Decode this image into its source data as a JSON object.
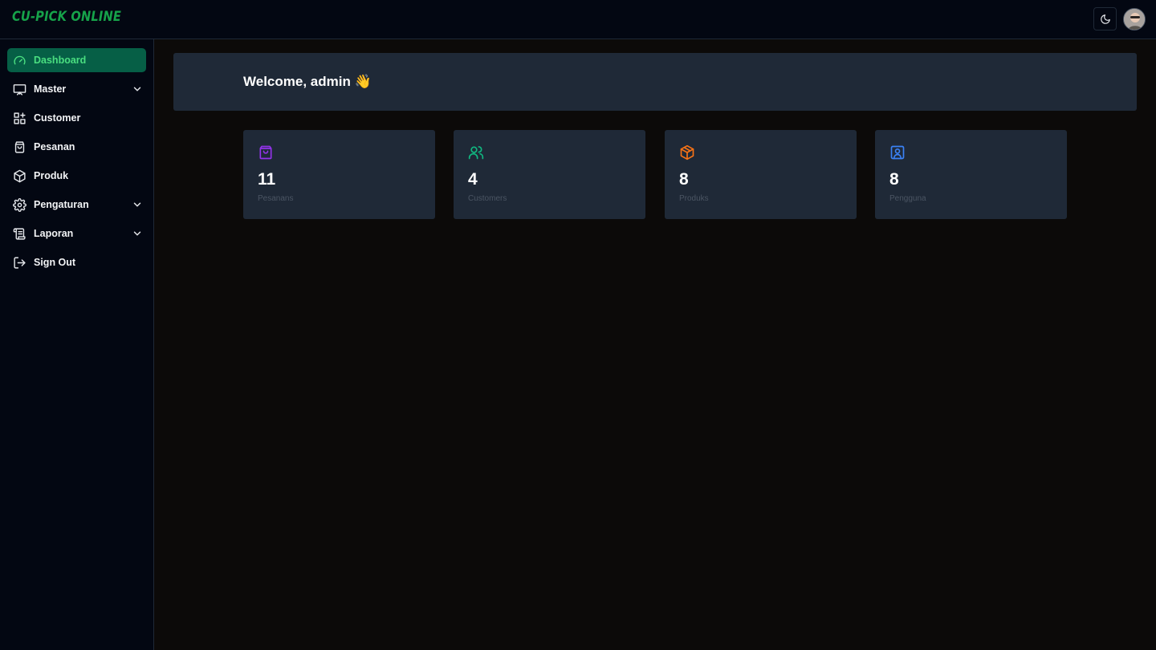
{
  "app": {
    "brand": "CU-PICK ONLINE",
    "accent": "#16a34a"
  },
  "header": {
    "theme_toggle_icon": "moon-icon",
    "avatar": "user-avatar"
  },
  "sidebar": {
    "items": [
      {
        "label": "Dashboard",
        "icon": "gauge-icon",
        "active": true,
        "has_submenu": false
      },
      {
        "label": "Master",
        "icon": "presentation-icon",
        "active": false,
        "has_submenu": true
      },
      {
        "label": "Customer",
        "icon": "grid-plus-icon",
        "active": false,
        "has_submenu": false
      },
      {
        "label": "Pesanan",
        "icon": "shopping-bag-icon",
        "active": false,
        "has_submenu": false
      },
      {
        "label": "Produk",
        "icon": "box-icon",
        "active": false,
        "has_submenu": false
      },
      {
        "label": "Pengaturan",
        "icon": "gear-icon",
        "active": false,
        "has_submenu": true
      },
      {
        "label": "Laporan",
        "icon": "scroll-icon",
        "active": false,
        "has_submenu": true
      },
      {
        "label": "Sign Out",
        "icon": "sign-out-icon",
        "active": false,
        "has_submenu": false
      }
    ]
  },
  "main": {
    "welcome": "Welcome, admin",
    "welcome_emoji": "👋",
    "stats": [
      {
        "value": "11",
        "label": "Pesanans",
        "icon": "shopping-bag-icon",
        "color": "#9333ea"
      },
      {
        "value": "4",
        "label": "Customers",
        "icon": "users-icon",
        "color": "#10b981"
      },
      {
        "value": "8",
        "label": "Produks",
        "icon": "box-icon",
        "color": "#f97316"
      },
      {
        "value": "8",
        "label": "Pengguna",
        "icon": "user-square-icon",
        "color": "#3b82f6"
      }
    ]
  }
}
